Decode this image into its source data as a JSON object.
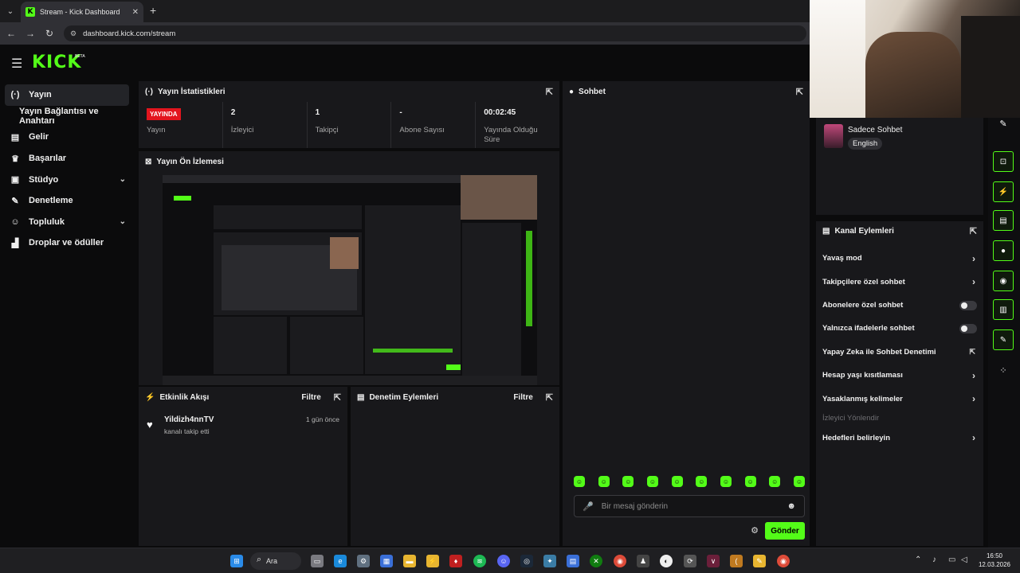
{
  "browser": {
    "tab_title": "Stream - Kick Dashboard",
    "url": "dashboard.kick.com/stream",
    "new_tab": "+",
    "close": "✕"
  },
  "app": {
    "logo": "KICK",
    "beta": "BETA"
  },
  "sidebar": {
    "items": [
      {
        "label": "Yayın",
        "icon": "broadcast-icon"
      },
      {
        "label": "Yayın Bağlantısı ve Anahtarı"
      },
      {
        "label": "Gelir",
        "icon": "chart-icon"
      },
      {
        "label": "Başarılar",
        "icon": "trophy-icon"
      },
      {
        "label": "Stüdyo",
        "icon": "studio-icon"
      },
      {
        "label": "Denetleme",
        "icon": "wrench-icon"
      },
      {
        "label": "Topluluk",
        "icon": "people-icon"
      },
      {
        "label": "Droplar ve ödüller",
        "icon": "gift-icon"
      }
    ]
  },
  "stats_panel": {
    "title": "Yayın İstatistikleri",
    "live_badge": "YAYINDA",
    "stats": [
      {
        "value": "",
        "label": "Yayın"
      },
      {
        "value": "2",
        "label": "İzleyici"
      },
      {
        "value": "1",
        "label": "Takipçi"
      },
      {
        "value": "-",
        "label": "Abone Sayısı"
      },
      {
        "value": "00:02:45",
        "label": "Yayında Olduğu Süre"
      }
    ]
  },
  "preview_panel": {
    "title": "Yayın Ön İzlemesi"
  },
  "activity_panel": {
    "title": "Etkinlik Akışı",
    "filter": "Filtre",
    "events": [
      {
        "user": "Yildizh4nnTV",
        "desc": "kanalı takip etti",
        "time": "1 gün önce"
      }
    ]
  },
  "moderation_panel": {
    "title": "Denetim Eylemleri",
    "filter": "Filtre"
  },
  "chat_panel": {
    "title": "Sohbet",
    "placeholder": "Bir mesaj gönderin",
    "send": "Gönder"
  },
  "chat_mode": {
    "title": "Sadece Sohbet",
    "language": "English"
  },
  "channel_actions": {
    "title": "Kanal Eylemleri",
    "items": [
      {
        "label": "Yavaş mod",
        "control": "arrow"
      },
      {
        "label": "Takipçilere özel sohbet",
        "control": "arrow"
      },
      {
        "label": "Abonelere özel sohbet",
        "control": "toggle",
        "on": false
      },
      {
        "label": "Yalnızca ifadelerle sohbet",
        "control": "toggle",
        "on": false
      },
      {
        "label": "Yapay Zeka ile Sohbet Denetimi",
        "control": "external"
      },
      {
        "label": "Hesap yaşı kısıtlaması",
        "control": "arrow"
      },
      {
        "label": "Yasaklanmış kelimeler",
        "control": "arrow"
      },
      {
        "label": "İzleyici Yönlendir",
        "control": "none",
        "disabled": true
      },
      {
        "label": "Hedefleri belirleyin",
        "control": "arrow"
      }
    ]
  },
  "taskbar": {
    "search": "Ara",
    "time": "16:50",
    "date": "12.03.2026"
  },
  "colors": {
    "brand": "#53fc18",
    "live": "#e3151e",
    "panel": "#18181b"
  }
}
